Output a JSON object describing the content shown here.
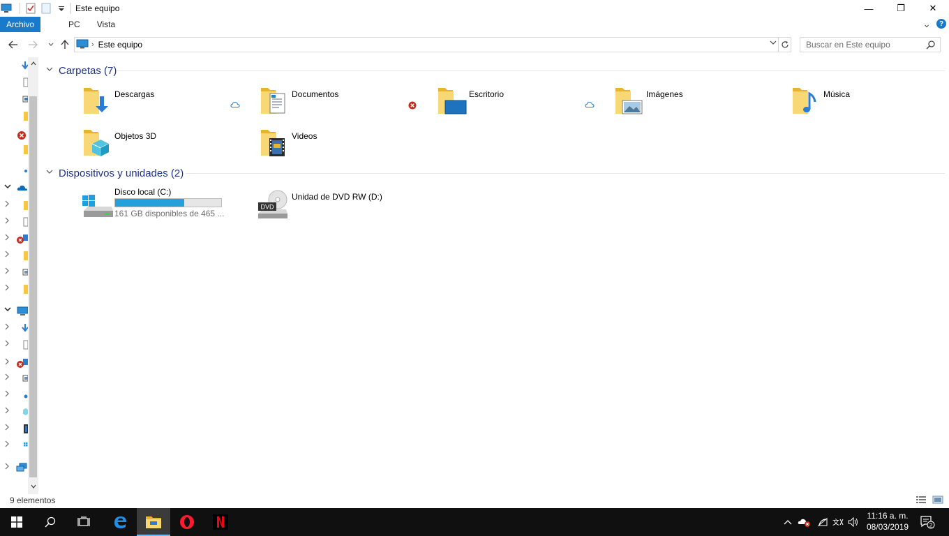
{
  "window": {
    "title": "Este equipo",
    "minimize": "—",
    "maximize": "❐",
    "close": "✕"
  },
  "ribbon": {
    "tabs": [
      {
        "label": "Archivo"
      },
      {
        "label": "PC"
      },
      {
        "label": "Vista"
      }
    ],
    "expand_glyph": "⌄",
    "help": "?"
  },
  "address": {
    "breadcrumb": "Este equipo",
    "search_placeholder": "Buscar en Este equipo"
  },
  "folders_group": {
    "title": "Carpetas (7)",
    "items": [
      {
        "name": "Descargas",
        "status": "cloud"
      },
      {
        "name": "Documentos",
        "status": "error"
      },
      {
        "name": "Escritorio",
        "status": "cloud"
      },
      {
        "name": "Imágenes",
        "status": ""
      },
      {
        "name": "Música",
        "status": ""
      },
      {
        "name": "Objetos 3D",
        "status": ""
      },
      {
        "name": "Videos",
        "status": ""
      }
    ]
  },
  "devices_group": {
    "title": "Dispositivos y unidades (2)",
    "items": [
      {
        "name": "Disco local (C:)",
        "free_text": "161 GB disponibles de 465 ...",
        "used_fraction": 0.654
      },
      {
        "name": "Unidad de DVD RW (D:)",
        "label": "DVD"
      }
    ]
  },
  "statusbar": {
    "text": "9 elementos"
  },
  "taskbar": {
    "time": "11:16 a. m.",
    "date": "08/03/2019",
    "notifications": "2"
  },
  "colors": {
    "accent": "#1979ca",
    "group_title": "#1e3287",
    "drive_fill": "#26a0da",
    "folder": "#f5c743"
  }
}
